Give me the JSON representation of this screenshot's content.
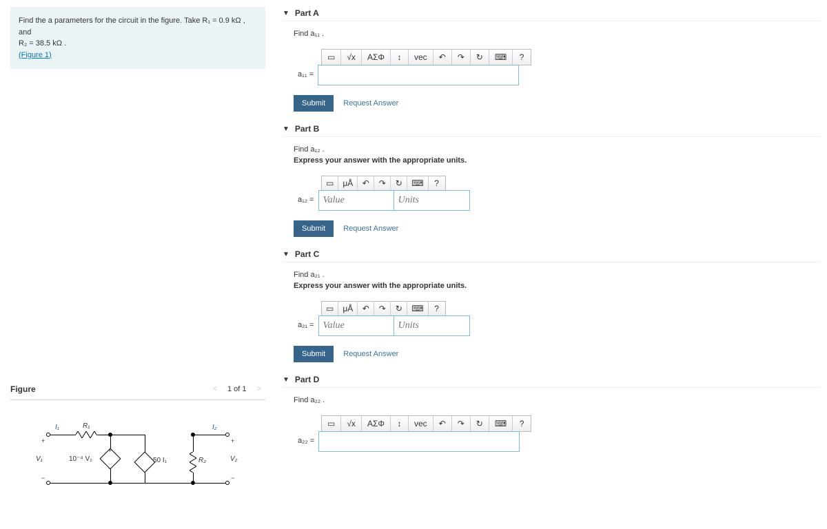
{
  "prompt": {
    "line1": "Find the a parameters for the circuit in the figure. Take R₁ = 0.9 kΩ , and",
    "line2": "R₂ = 38.5 kΩ .",
    "figlink": "(Figure 1)"
  },
  "figure": {
    "title": "Figure",
    "nav_prev": "<",
    "nav_text": "1 of 1",
    "nav_next": ">",
    "labels": {
      "I1": "I₁",
      "I2": "I₂",
      "R1": "R₁",
      "R2": "R₂",
      "V1": "V₁",
      "V2": "V₂",
      "src": "10⁻⁴ V₂",
      "gain": "50 I₁"
    }
  },
  "parts": {
    "A": {
      "title": "Part A",
      "instr1": "Find a₁₁ .",
      "label": "a₁₁ =",
      "submit": "Submit",
      "request": "Request Answer",
      "tools": [
        "√x",
        "ΑΣΦ",
        "↕",
        "vec",
        "↶",
        "↷",
        "↻",
        "⌨",
        "?"
      ]
    },
    "B": {
      "title": "Part B",
      "instr1": "Find a₁₂ .",
      "instr2": "Express your answer with the appropriate units.",
      "label": "a₁₂ =",
      "value_ph": "Value",
      "units_ph": "Units",
      "submit": "Submit",
      "request": "Request Answer",
      "tools": [
        "μÅ",
        "↶",
        "↷",
        "↻",
        "⌨",
        "?"
      ]
    },
    "C": {
      "title": "Part C",
      "instr1": "Find a₂₁ .",
      "instr2": "Express your answer with the appropriate units.",
      "label": "a₂₁ =",
      "value_ph": "Value",
      "units_ph": "Units",
      "submit": "Submit",
      "request": "Request Answer",
      "tools": [
        "μÅ",
        "↶",
        "↷",
        "↻",
        "⌨",
        "?"
      ]
    },
    "D": {
      "title": "Part D",
      "instr1": "Find a₂₂ .",
      "label": "a₂₂ =",
      "tools": [
        "√x",
        "ΑΣΦ",
        "↕",
        "vec",
        "↶",
        "↷",
        "↻",
        "⌨",
        "?"
      ]
    }
  }
}
